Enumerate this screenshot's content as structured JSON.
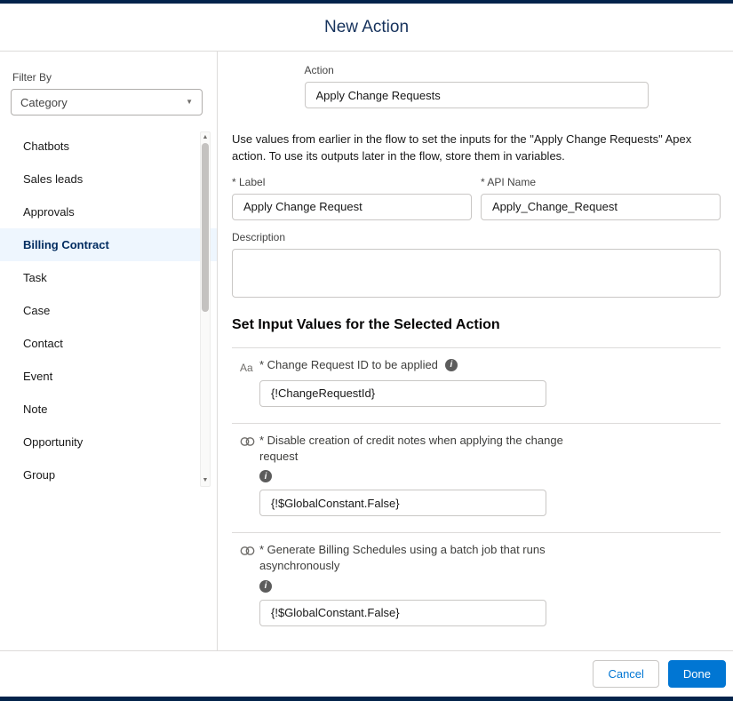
{
  "modal": {
    "title": "New Action"
  },
  "sidebar": {
    "filter_by_label": "Filter By",
    "category_value": "Category",
    "items": [
      {
        "label": "Chatbots"
      },
      {
        "label": "Sales leads"
      },
      {
        "label": "Approvals"
      },
      {
        "label": "Billing Contract",
        "selected": true
      },
      {
        "label": "Task"
      },
      {
        "label": "Case"
      },
      {
        "label": "Contact"
      },
      {
        "label": "Event"
      },
      {
        "label": "Note"
      },
      {
        "label": "Opportunity"
      },
      {
        "label": "Group"
      }
    ]
  },
  "action": {
    "label": "Action",
    "value": "Apply Change Requests"
  },
  "intro_text": "Use values from earlier in the flow to set the inputs for the \"Apply Change Requests\" Apex action. To use its outputs later in the flow, store them in variables.",
  "fields": {
    "label": {
      "label": "* Label",
      "value": "Apply Change Request"
    },
    "api_name": {
      "label": "* API Name",
      "value": "Apply_Change_Request"
    },
    "description": {
      "label": "Description",
      "value": ""
    }
  },
  "input_values": {
    "heading": "Set Input Values for the Selected Action",
    "rows": [
      {
        "type": "text",
        "label": "* Change Request ID to be applied",
        "value": "{!ChangeRequestId}"
      },
      {
        "type": "boolean",
        "label": "* Disable creation of credit notes when applying the change request",
        "value": "{!$GlobalConstant.False}"
      },
      {
        "type": "boolean",
        "label": "* Generate Billing Schedules using a batch job that runs asynchronously",
        "value": "{!$GlobalConstant.False}"
      }
    ]
  },
  "footer": {
    "cancel_label": "Cancel",
    "done_label": "Done"
  },
  "icons": {
    "text_type_glyph": "Aa",
    "info_glyph": "i",
    "dropdown_caret": "▼",
    "scroll_up": "▲",
    "scroll_down": "▼"
  },
  "colors": {
    "accent": "#0176d3",
    "selected_bg": "#eef6fe",
    "backdrop": "#03234b"
  }
}
